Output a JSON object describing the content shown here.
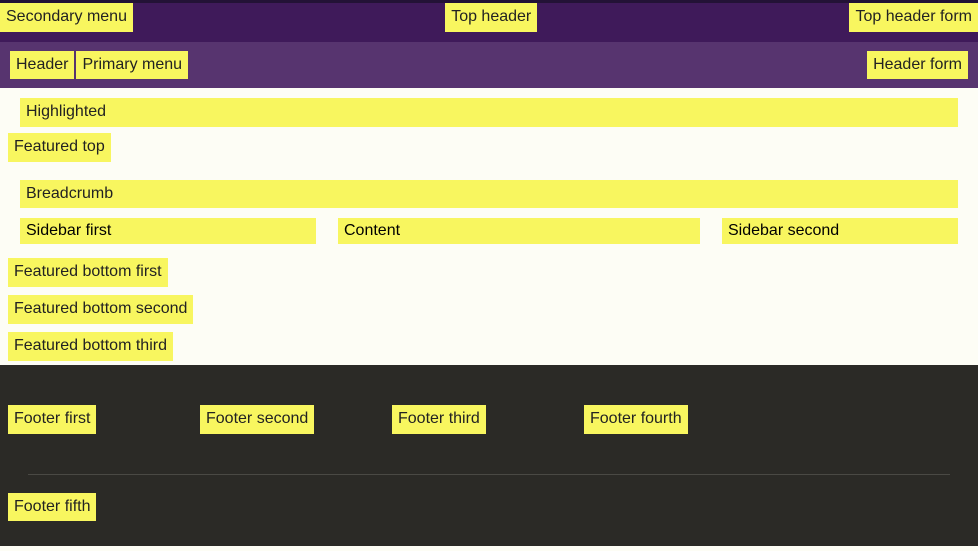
{
  "topbar": {
    "secondary_menu": "Secondary menu",
    "top_header": "Top header",
    "top_header_form": "Top header form"
  },
  "headerbar": {
    "header": "Header",
    "primary_menu": "Primary menu",
    "header_form": "Header form"
  },
  "highlighted": "Highlighted",
  "featured_top": "Featured top",
  "breadcrumb": "Breadcrumb",
  "columns": {
    "sidebar_first": "Sidebar first",
    "content": "Content",
    "sidebar_second": "Sidebar second"
  },
  "featured_bottom": {
    "first": "Featured bottom first",
    "second": "Featured bottom second",
    "third": "Featured bottom third"
  },
  "footer": {
    "first": "Footer first",
    "second": "Footer second",
    "third": "Footer third",
    "fourth": "Footer fourth",
    "fifth": "Footer fifth"
  }
}
